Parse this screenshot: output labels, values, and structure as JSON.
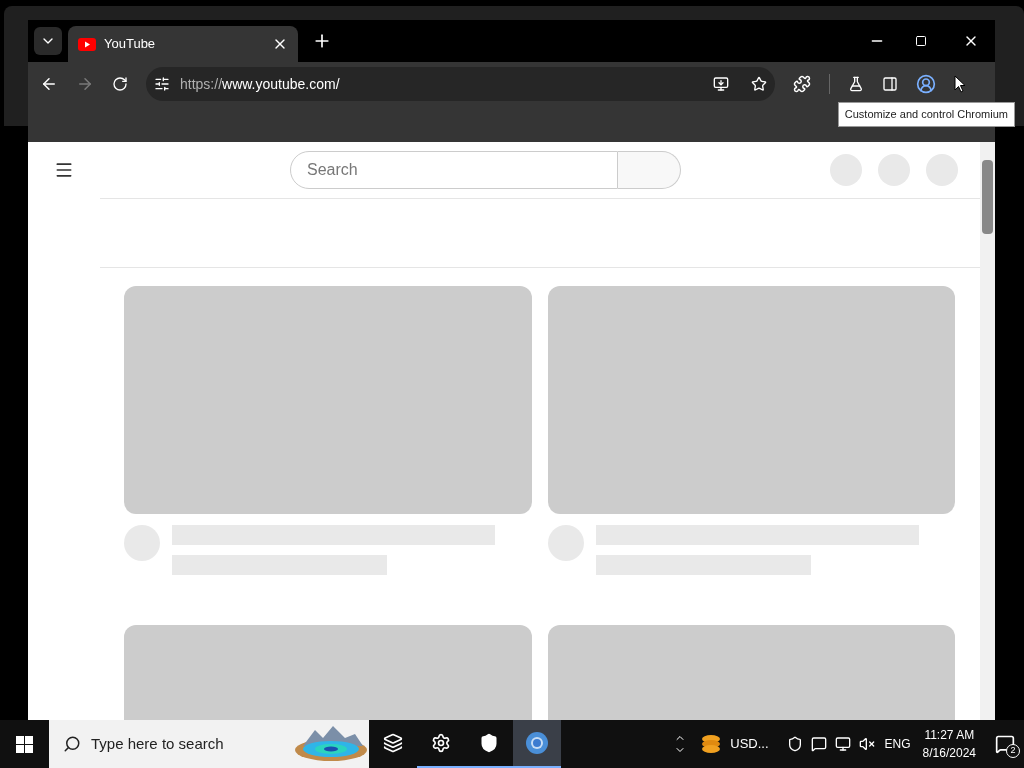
{
  "browser": {
    "tabs": [
      {
        "title": "YouTube",
        "selected": true
      }
    ],
    "url": {
      "scheme": "https://",
      "host": "www.youtube.com/"
    },
    "tooltip": "Customize and control Chromium"
  },
  "page": {
    "search": {
      "placeholder": "Search"
    },
    "cards": [
      {
        "kind": "skeleton"
      },
      {
        "kind": "skeleton"
      },
      {
        "kind": "thumbnail"
      },
      {
        "kind": "thumbnail"
      }
    ]
  },
  "taskbar": {
    "search_placeholder": "Type here to search",
    "apps": [
      {
        "kind": "task-view",
        "running": false,
        "selected": false
      },
      {
        "kind": "settings",
        "running": true,
        "selected": false
      },
      {
        "kind": "security",
        "running": true,
        "selected": false
      },
      {
        "kind": "browser",
        "running": true,
        "selected": true
      }
    ],
    "tray_app": "USD...",
    "language": "ENG",
    "time": "11:27 AM",
    "date": "8/16/2024",
    "notifications": "2"
  }
}
